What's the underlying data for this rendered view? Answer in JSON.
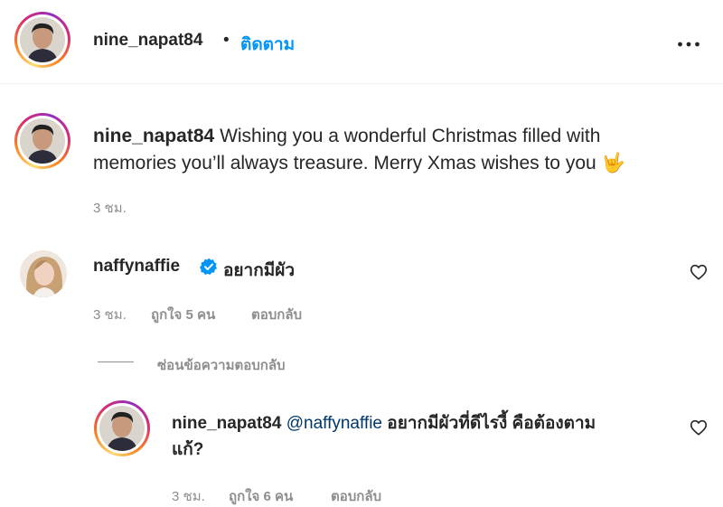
{
  "header": {
    "username": "nine_napat84",
    "separator": "•",
    "follow_label": "ติดตาม"
  },
  "caption": {
    "username": "nine_napat84",
    "text_line1": "Wishing you a wonderful Christmas filled with",
    "text_line2": "memories you’ll always treasure. Merry Xmas wishes to you",
    "emoji": "🤟",
    "time": "3 ชม."
  },
  "comment": {
    "username": "naffynaffie",
    "verified": true,
    "text": "อยากมีผัว",
    "time": "3 ชม.",
    "likes": "ถูกใจ 5 คน",
    "reply_label": "ตอบกลับ",
    "hide_replies_label": "ซ่อนข้อความตอบกลับ"
  },
  "reply": {
    "username": "nine_napat84",
    "mention": "@naffynaffie",
    "text_line1": "อยากมีผัวที่ดีไรงี้ คือต้องตาม",
    "text_line2": "แก้?",
    "time": "3 ชม.",
    "likes": "ถูกใจ 6 คน",
    "reply_label": "ตอบกลับ"
  },
  "icons": {
    "more": "more-options-icon",
    "heart": "heart-icon",
    "verified": "verified-badge-icon"
  },
  "colors": {
    "follow": "#0095f6",
    "verified": "#0095f6",
    "muted": "#8e8e8e",
    "mention": "#00376b"
  }
}
